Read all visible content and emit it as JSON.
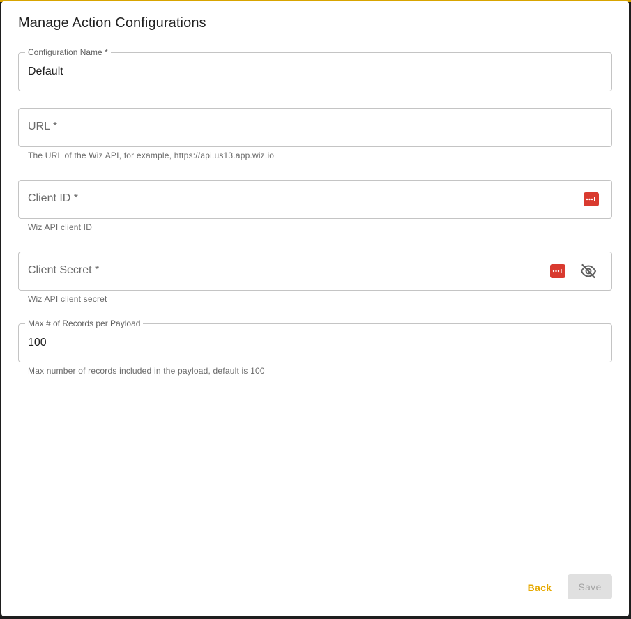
{
  "dialog": {
    "title": "Manage Action Configurations"
  },
  "fields": {
    "config_name": {
      "label": "Configuration Name *",
      "value": "Default"
    },
    "url": {
      "placeholder": "URL *",
      "helper": "The URL of the Wiz API, for example, https://api.us13.app.wiz.io"
    },
    "client_id": {
      "placeholder": "Client ID *",
      "helper": "Wiz API client ID",
      "icon": "password-manager-icon"
    },
    "client_secret": {
      "placeholder": "Client Secret *",
      "helper": "Wiz API client secret",
      "icons": [
        "password-manager-icon",
        "visibility-off-icon"
      ]
    },
    "max_records": {
      "label": "Max # of Records per Payload",
      "value": "100",
      "helper": "Max number of records included in the payload, default is 100"
    }
  },
  "actions": {
    "back_label": "Back",
    "save_label": "Save"
  },
  "colors": {
    "accent": "#e6a900",
    "password_icon": "#d93a2f",
    "disabled_button_bg": "#e0e0e0"
  }
}
